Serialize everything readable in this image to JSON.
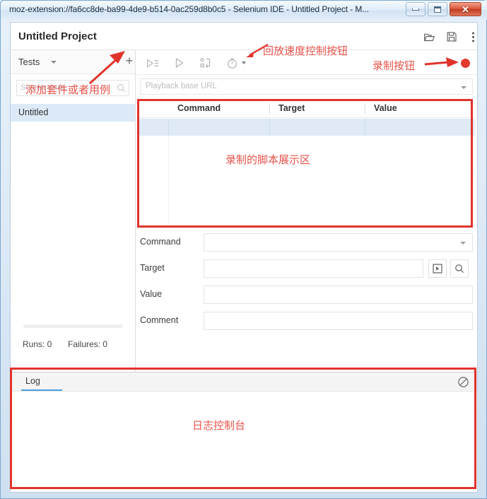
{
  "window": {
    "title": "moz-extension://fa6cc8de-ba99-4de9-b514-0ac259d8b0c5 - Selenium IDE - Untitled Project - M...",
    "minimize_label": "–",
    "maximize_label": "□",
    "close_label": "✕"
  },
  "header": {
    "project_title": "Untitled Project",
    "icons": [
      {
        "name": "open-project-icon",
        "label": "Open project"
      },
      {
        "name": "save-project-icon",
        "label": "Save project"
      },
      {
        "name": "more-options-icon",
        "label": "More options"
      }
    ]
  },
  "sidebar": {
    "tests_label": "Tests",
    "add_button_label": "+",
    "search_placeholder": "Search tests...",
    "tests": [
      {
        "label": "Untitled",
        "selected": true
      }
    ],
    "runs_label": "Runs: 0",
    "failures_label": "Failures: 0"
  },
  "toolbar": {
    "buttons": [
      {
        "name": "run-all-tests-icon",
        "label": "Run all tests"
      },
      {
        "name": "run-current-test-icon",
        "label": "Run current test"
      },
      {
        "name": "step-over-icon",
        "label": "Step over current command"
      },
      {
        "name": "playback-speed-icon",
        "label": "Playback speed"
      }
    ],
    "record_button_label": "Record"
  },
  "baseurl": {
    "placeholder": "Playback base URL",
    "value": ""
  },
  "command_table": {
    "columns": [
      "Command",
      "Target",
      "Value"
    ],
    "rows": [
      {
        "command": "",
        "target": "",
        "value": "",
        "selected": true
      }
    ]
  },
  "form": {
    "fields": [
      {
        "name": "command",
        "label": "Command",
        "value": "",
        "placeholder": ""
      },
      {
        "name": "target",
        "label": "Target",
        "value": "",
        "placeholder": ""
      },
      {
        "name": "value",
        "label": "Value",
        "value": "",
        "placeholder": ""
      },
      {
        "name": "comment",
        "label": "Comment",
        "value": "",
        "placeholder": ""
      }
    ],
    "target_select_icon": "select-target-icon",
    "target_find_icon": "find-target-icon"
  },
  "log": {
    "tab_label": "Log",
    "clear_icon": "clear-log-icon",
    "entries": []
  },
  "annotations": {
    "playback_speed": "回放速度控制按钮",
    "record_button": "录制按钮",
    "add_suite_or_case": "添加套件或者用例",
    "script_area": "录制的脚本展示区",
    "log_console": "日志控制台"
  },
  "colors": {
    "annotation_red": "#e0332c",
    "record_red": "#e23b2e",
    "selection_blue": "#dceaf7",
    "tab_accent": "#4a9fe0"
  }
}
